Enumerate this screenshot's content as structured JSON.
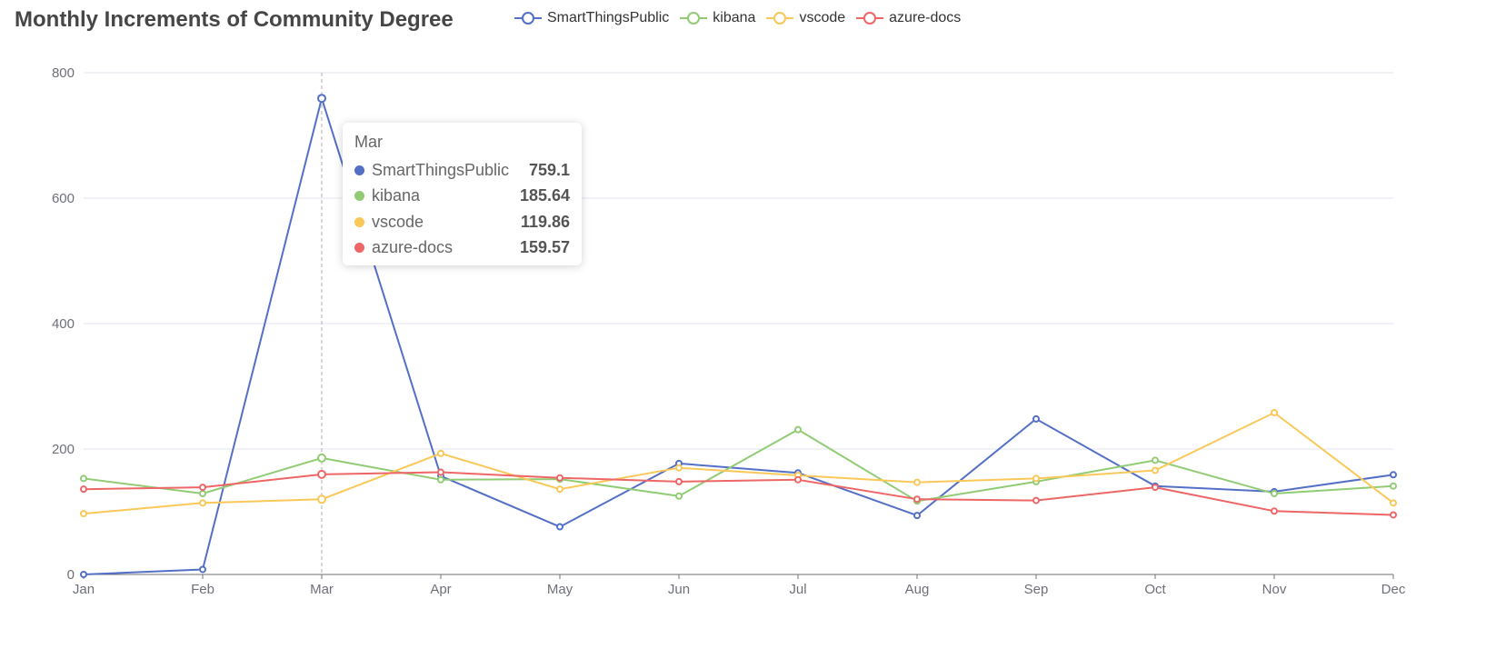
{
  "chart_data": {
    "type": "line",
    "title": "Monthly Increments of Community Degree",
    "categories": [
      "Jan",
      "Feb",
      "Mar",
      "Apr",
      "May",
      "Jun",
      "Jul",
      "Aug",
      "Sep",
      "Oct",
      "Nov",
      "Dec"
    ],
    "ylim": [
      0,
      800
    ],
    "yticks": [
      "0",
      "200",
      "400",
      "600",
      "800"
    ],
    "grid": true,
    "legend_position": "top-center",
    "series": [
      {
        "name": "SmartThingsPublic",
        "color": "#5470c6",
        "values": [
          0,
          8,
          759.1,
          157,
          76,
          177,
          162,
          94,
          248,
          141,
          132,
          159
        ]
      },
      {
        "name": "kibana",
        "color": "#91cc75",
        "values": [
          153,
          129,
          185.64,
          151,
          152,
          125,
          231,
          117,
          148,
          182,
          129,
          141
        ]
      },
      {
        "name": "vscode",
        "color": "#fac858",
        "values": [
          97,
          114,
          119.86,
          193,
          136,
          170,
          158,
          147,
          153,
          166,
          258,
          114
        ]
      },
      {
        "name": "azure-docs",
        "color": "#ee6666",
        "values": [
          136,
          139,
          159.57,
          163,
          154,
          148,
          151,
          120,
          118,
          139,
          101,
          95
        ]
      }
    ],
    "tooltip": {
      "category": "Mar",
      "rows": [
        {
          "name": "SmartThingsPublic",
          "value": "759.1",
          "color": "#5470c6"
        },
        {
          "name": "kibana",
          "value": "185.64",
          "color": "#91cc75"
        },
        {
          "name": "vscode",
          "value": "119.86",
          "color": "#fac858"
        },
        {
          "name": "azure-docs",
          "value": "159.57",
          "color": "#ee6666"
        }
      ]
    }
  }
}
